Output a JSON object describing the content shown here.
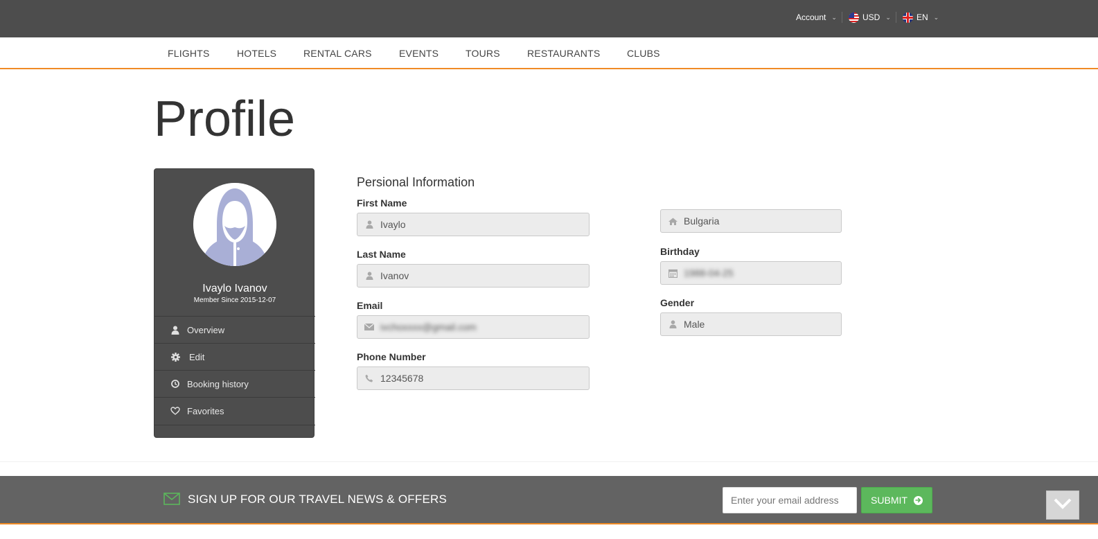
{
  "topbar": {
    "account_label": "Account",
    "currency_label": "USD",
    "language_label": "EN"
  },
  "nav": {
    "items": [
      "FLIGHTS",
      "HOTELS",
      "RENTAL CARS",
      "EVENTS",
      "TOURS",
      "RESTAURANTS",
      "CLUBS"
    ]
  },
  "page": {
    "title": "Profile"
  },
  "sidebar": {
    "user_name": "Ivaylo Ivanov",
    "member_since": "Member Since 2015-12-07",
    "menu": [
      "Overview",
      "Edit",
      "Booking history",
      "Favorites"
    ],
    "menu_icons": [
      "user-icon",
      "gear-icon",
      "clock-icon",
      "heart-icon"
    ]
  },
  "form": {
    "section_title": "Persional Information",
    "first_name_label": "First Name",
    "first_name_value": "Ivaylo",
    "last_name_label": "Last Name",
    "last_name_value": "Ivanov",
    "email_label": "Email",
    "email_value": "ivchoxxxx@gmail.com",
    "phone_label": "Phone Number",
    "phone_value": "12345678",
    "country_value": "Bulgaria",
    "birthday_label": "Birthday",
    "birthday_value": "1988-04-25",
    "gender_label": "Gender",
    "gender_value": "Male"
  },
  "newsletter": {
    "text": "SIGN UP FOR OUR TRAVEL NEWS & OFFERS",
    "email_placeholder": "Enter your email address",
    "submit_label": "SUBMIT"
  },
  "colors": {
    "accent_orange": "#f08a24",
    "dark_bar": "#4d4d4d",
    "submit_green": "#5cb85c"
  }
}
